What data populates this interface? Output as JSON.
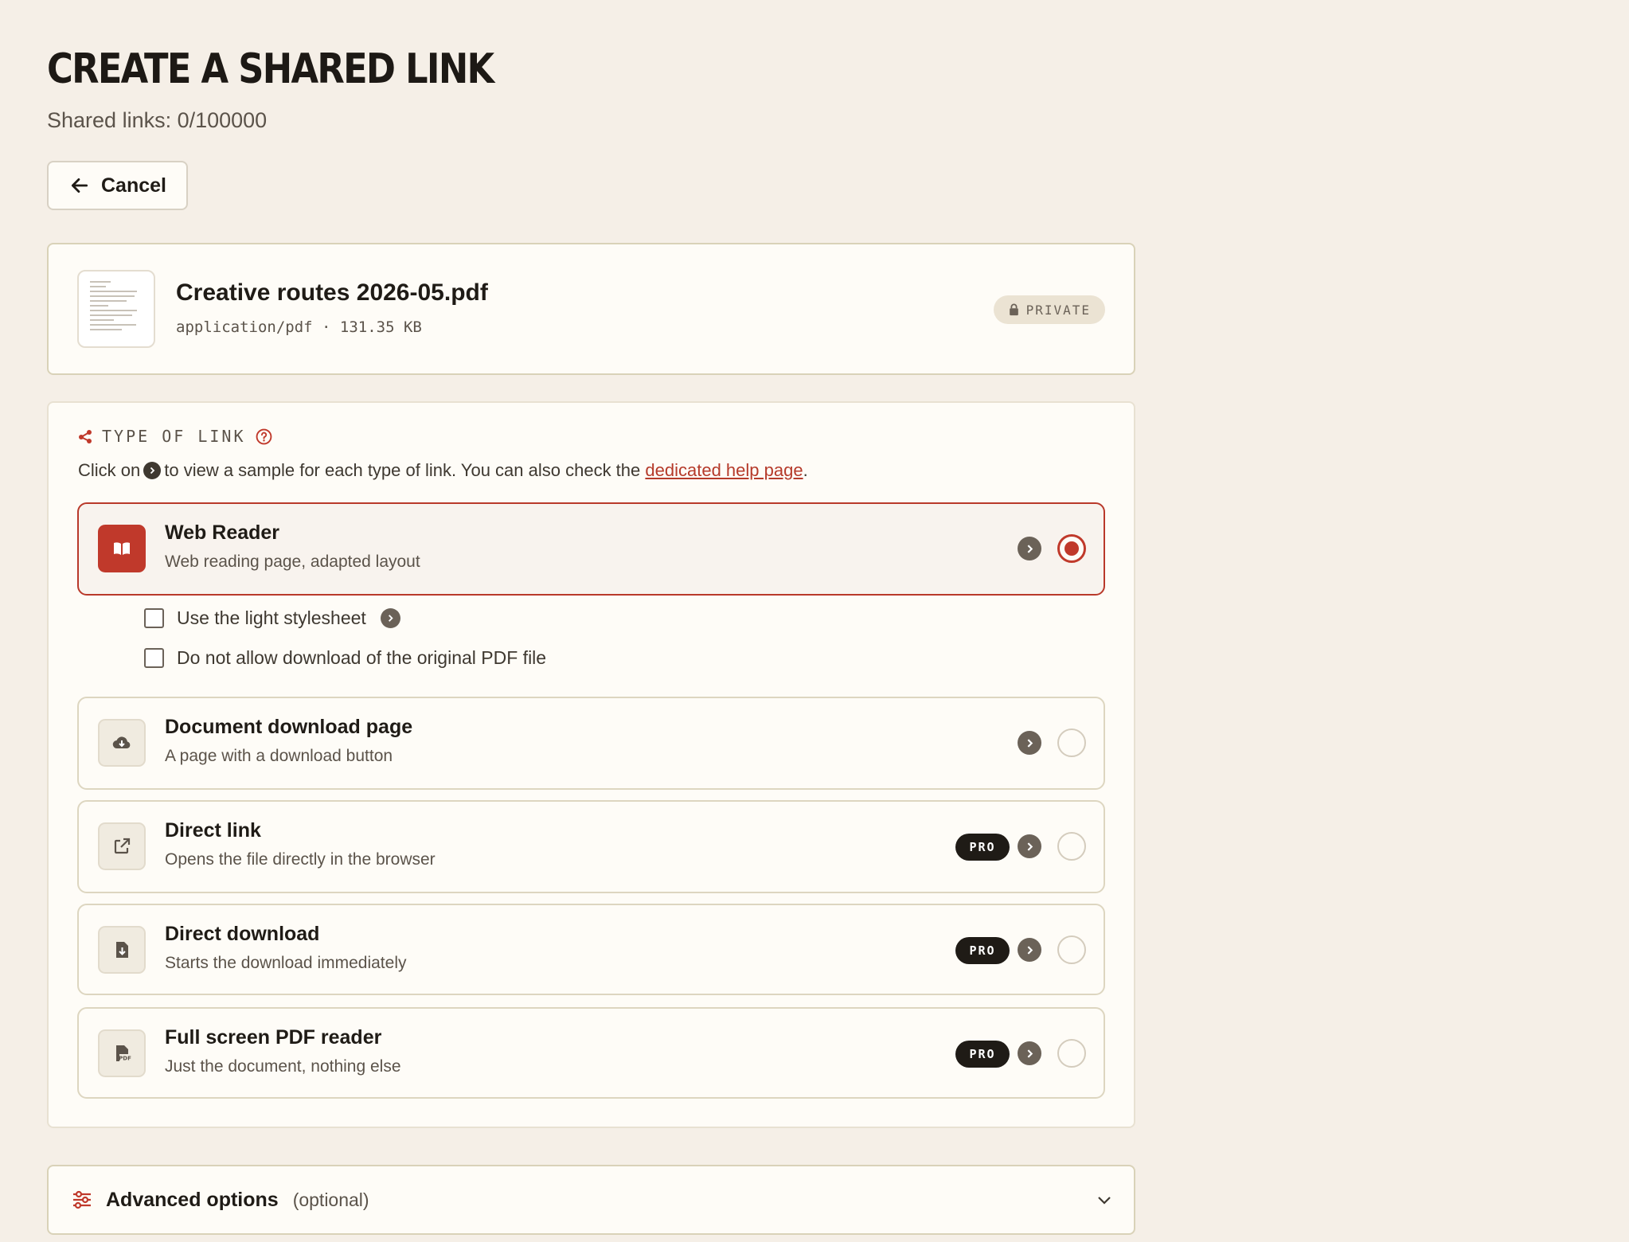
{
  "header": {
    "title": "CREATE A SHARED LINK",
    "shared_links": "Shared links: 0/100000",
    "cancel_label": "Cancel"
  },
  "file": {
    "name": "Creative routes 2026-05.pdf",
    "meta": "application/pdf · 131.35 KB",
    "visibility": "PRIVATE"
  },
  "link_type": {
    "heading": "TYPE OF LINK",
    "help_prefix": "Click on",
    "help_middle": "to view a sample for each type of link. You can also check the",
    "help_link": "dedicated help page",
    "help_suffix": ".",
    "options": [
      {
        "title": "Web Reader",
        "subtitle": "Web reading page, adapted layout",
        "icon": "book-icon",
        "selected": true,
        "pro": false
      },
      {
        "title": "Document download page",
        "subtitle": "A page with a download button",
        "icon": "cloud-download-icon",
        "selected": false,
        "pro": false
      },
      {
        "title": "Direct link",
        "subtitle": "Opens the file directly in the browser",
        "icon": "external-link-icon",
        "selected": false,
        "pro": true
      },
      {
        "title": "Direct download",
        "subtitle": "Starts the download immediately",
        "icon": "file-download-icon",
        "selected": false,
        "pro": true
      },
      {
        "title": "Full screen PDF reader",
        "subtitle": "Just the document, nothing else",
        "icon": "pdf-file-icon",
        "selected": false,
        "pro": true
      }
    ],
    "pro_label": "PRO",
    "web_reader_options": [
      {
        "label": "Use the light stylesheet",
        "checked": false
      },
      {
        "label": "Do not allow download of the original PDF file",
        "checked": false
      }
    ]
  },
  "advanced": {
    "label": "Advanced options",
    "optional": "(optional)"
  },
  "colors": {
    "accent": "#c0392b",
    "background": "#f5efe7",
    "card": "#fefcf7"
  }
}
